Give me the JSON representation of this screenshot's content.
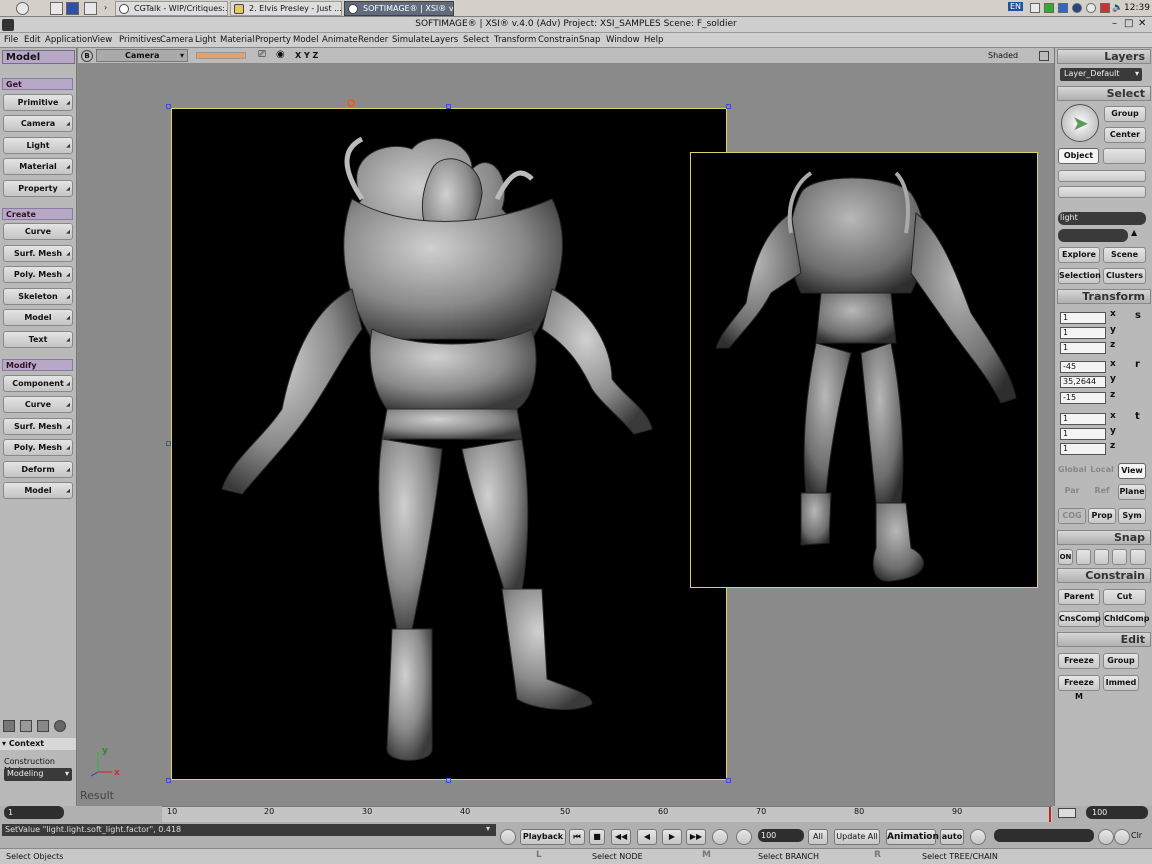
{
  "taskbar": {
    "tasks": [
      {
        "label": "CGTalk - WIP/Critiques:..."
      },
      {
        "label": "2. Elvis Presley - Just ..."
      },
      {
        "label": "SOFTIMAGE® | XSI® v..."
      }
    ],
    "tray": {
      "lang": "EN",
      "clock": "12:39"
    }
  },
  "window": {
    "title": "SOFTIMAGE® | XSI® v.4.0 (Adv) Project: XSI_SAMPLES    Scene: F_soldier"
  },
  "menu": [
    "File",
    "Edit",
    "Application",
    "View",
    "Primitives",
    "Camera",
    "Light",
    "Material",
    "Property",
    "Model",
    "Animate",
    "Render",
    "Simulate",
    "Layers",
    "Select",
    "Transform",
    "Constrain",
    "Snap",
    "Window",
    "Help"
  ],
  "left": {
    "mode": "Model",
    "get_title": "Get",
    "get": [
      "Primitive",
      "Camera",
      "Light",
      "Material",
      "Property"
    ],
    "create_title": "Create",
    "create": [
      "Curve",
      "Surf. Mesh",
      "Poly. Mesh",
      "Skeleton",
      "Model",
      "Text"
    ],
    "modify_title": "Modify",
    "modify": [
      "Component",
      "Curve",
      "Surf. Mesh",
      "Poly. Mesh",
      "Deform",
      "Model"
    ],
    "context_label": "Context",
    "construction_label": "Construction Mode",
    "construction_value": "Modeling"
  },
  "viewport": {
    "view_letter": "B",
    "camera": "Camera",
    "axes": "X  Y  Z",
    "shading": "Shaded",
    "result_label": "Result",
    "axis_x": "x",
    "axis_y": "y"
  },
  "right": {
    "layers_title": "Layers",
    "layer_value": "Layer_Default",
    "select_title": "Select",
    "group_btn": "Group",
    "center_btn": "Center",
    "object_btn": "Object",
    "search_value": "light",
    "explore_btn": "Explore",
    "scene_btn": "Scene",
    "selection_btn": "Selection",
    "clusters_btn": "Clusters",
    "transform_title": "Transform",
    "scale": [
      "1",
      "1",
      "1"
    ],
    "rotate": [
      "-45",
      "35,2644",
      "-15"
    ],
    "translate": [
      "1",
      "1",
      "1"
    ],
    "axes": [
      "x",
      "y",
      "z"
    ],
    "ref_row1": [
      "Global",
      "Local",
      "View"
    ],
    "ref_row2": [
      "Par",
      "Ref",
      "Plane"
    ],
    "ref_row3": [
      "COG",
      "Prop",
      "Sym"
    ],
    "snap_title": "Snap",
    "snap_on": "ON",
    "constrain_title": "Constrain",
    "constrain_btns": [
      "Parent",
      "Cut",
      "CnsComp",
      "ChldComp"
    ],
    "edit_title": "Edit",
    "edit_btns": [
      "Freeze",
      "Group",
      "Freeze M",
      "Immed"
    ]
  },
  "timeline": {
    "start": "1",
    "end": "100",
    "ticks": [
      "10",
      "20",
      "30",
      "40",
      "50",
      "60",
      "70",
      "80",
      "90"
    ]
  },
  "bottom": {
    "command": "SetValue \"light.light.soft_light.factor\", 0.418",
    "playback": "Playback",
    "frame": "100",
    "all": "All",
    "update": "Update All",
    "animation": "Animation",
    "auto": "auto",
    "clr": "Clr",
    "status_left": "Select Objects",
    "status_l_key": "L",
    "status_l": "Select NODE",
    "status_m_key": "M",
    "status_m": "Select BRANCH",
    "status_r_key": "R",
    "status_r": "Select TREE/CHAIN"
  },
  "colors": {
    "selection_frame": "#e0d060",
    "handle": "#3a4fd8",
    "purple_header": "#b8a8c8"
  }
}
